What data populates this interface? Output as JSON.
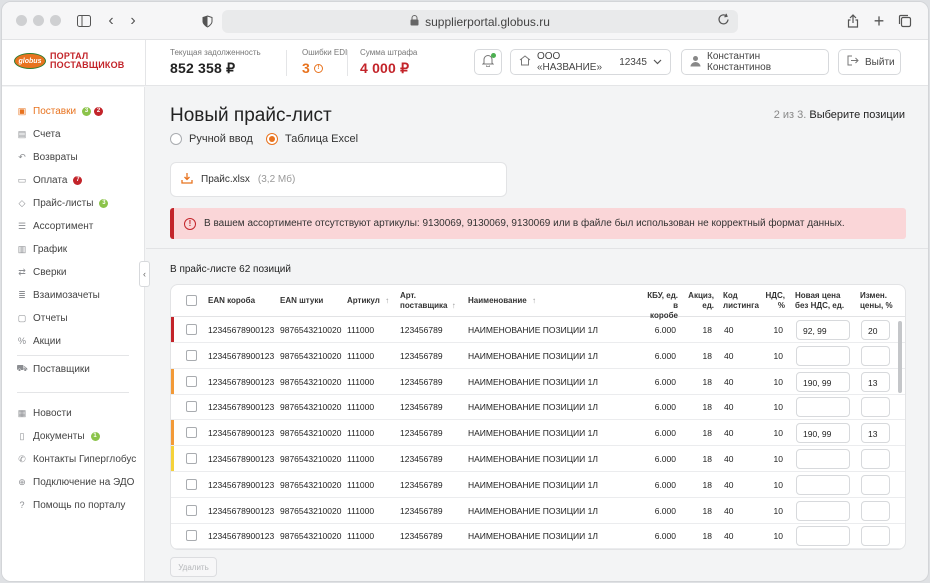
{
  "browser": {
    "url": "supplierportal.globus.ru"
  },
  "logo": {
    "badge": "globus",
    "line1": "ПОРТАЛ",
    "line2": "ПОСТАВЩИКОВ"
  },
  "header": {
    "debt_label": "Текущая задолженность",
    "debt_value": "852 358 ₽",
    "edi_label": "Ошибки EDI",
    "edi_value": "3",
    "fine_label": "Сумма штрафа",
    "fine_value": "4 000 ₽",
    "org_name": "ООО «НАЗВАНИЕ»",
    "org_code": "12345",
    "user_name": "Константин Константинов",
    "logout_label": "Выйти"
  },
  "sidebar": {
    "items": [
      {
        "label": "Поставки",
        "badges": [
          "3",
          "2"
        ],
        "icon": "box-icon"
      },
      {
        "label": "Счета",
        "icon": "document-icon"
      },
      {
        "label": "Возвраты",
        "icon": "return-icon"
      },
      {
        "label": "Оплата",
        "badges": [
          "7"
        ],
        "icon": "wallet-icon"
      },
      {
        "label": "Прайс-листы",
        "badges": [
          "3"
        ],
        "icon": "tag-icon"
      },
      {
        "label": "Ассортимент",
        "icon": "list-icon"
      },
      {
        "label": "График",
        "icon": "chart-icon"
      },
      {
        "label": "Сверки",
        "icon": "swap-icon"
      },
      {
        "label": "Взаимозачеты",
        "icon": "stack-icon"
      },
      {
        "label": "Отчеты",
        "icon": "report-icon"
      },
      {
        "label": "Акции",
        "icon": "percent-icon"
      },
      {
        "label": "Поставщики",
        "icon": "truck-icon"
      },
      {
        "label": "Новости",
        "icon": "news-icon"
      },
      {
        "label": "Документы",
        "badges": [
          "1"
        ],
        "icon": "file-icon"
      },
      {
        "label": "Контакты Гиперглобус",
        "icon": "phone-icon"
      },
      {
        "label": "Подключение на ЭДО",
        "icon": "plug-icon"
      },
      {
        "label": "Помощь по порталу",
        "icon": "help-icon"
      }
    ]
  },
  "page": {
    "title": "Новый прайс-лист",
    "step_prefix": "2 из 3.",
    "step_text": "Выберите позиции",
    "radio_manual": "Ручной ввод",
    "radio_excel": "Таблица Excel",
    "file_name": "Прайс.xlsx",
    "file_size": "(3,2 Мб)",
    "alert": "В вашем ассортименте отсутствуют артикулы: 9130069, 9130069, 9130069 или в файле был использован не корректный формат данных.",
    "count_text": "В прайс-листе 62 позиций",
    "delete_label": "Удалить"
  },
  "colors": {
    "accent": "#e8731f",
    "danger": "#c3242a",
    "green": "#2e7d32",
    "warning_orange": "#f29a38",
    "warning_yellow": "#f5d23a",
    "badge_green": "#8bc34a"
  },
  "table": {
    "headers": {
      "ean_box": "EAN короба",
      "ean_piece": "EAN штуки",
      "article": "Артикул",
      "supplier_article_1": "Арт.",
      "supplier_article_2": "поставщика",
      "name": "Наименование",
      "kbu_1": "КБУ, ед.",
      "kbu_2": "в коробе",
      "excise_1": "Акциз,",
      "excise_2": "ед.",
      "listing_1": "Код",
      "listing_2": "листинга",
      "vat_1": "НДС,",
      "vat_2": "%",
      "price_1": "Новая цена",
      "price_2": "без НДС, ед.",
      "change_1": "Измен.",
      "change_2": "цены, %"
    },
    "rows": [
      {
        "mark": "red",
        "ean_box": "12345678900123",
        "ean_piece": "9876543210020",
        "article": "111000",
        "supplier_article": "123456789",
        "name": "НАИМЕНОВАНИЕ ПОЗИЦИИ 1Л",
        "kbu": "6.000",
        "excise": "18",
        "listing": "40",
        "vat": "10",
        "price": "92, 99",
        "change": "20"
      },
      {
        "mark": "",
        "ean_box": "12345678900123",
        "ean_piece": "9876543210020",
        "article": "111000",
        "supplier_article": "123456789",
        "name": "НАИМЕНОВАНИЕ ПОЗИЦИИ 1Л",
        "kbu": "6.000",
        "excise": "18",
        "listing": "40",
        "vat": "10",
        "price": "",
        "change": ""
      },
      {
        "mark": "orange",
        "ean_box": "12345678900123",
        "ean_piece": "9876543210020",
        "article": "111000",
        "supplier_article": "123456789",
        "name": "НАИМЕНОВАНИЕ ПОЗИЦИИ 1Л",
        "kbu": "6.000",
        "excise": "18",
        "listing": "40",
        "vat": "10",
        "price": "190, 99",
        "change": "13"
      },
      {
        "mark": "",
        "ean_box": "12345678900123",
        "ean_piece": "9876543210020",
        "article": "111000",
        "supplier_article": "123456789",
        "name": "НАИМЕНОВАНИЕ ПОЗИЦИИ 1Л",
        "kbu": "6.000",
        "excise": "18",
        "listing": "40",
        "vat": "10",
        "price": "",
        "change": ""
      },
      {
        "mark": "orange",
        "ean_box": "12345678900123",
        "ean_piece": "9876543210020",
        "article": "111000",
        "supplier_article": "123456789",
        "name": "НАИМЕНОВАНИЕ ПОЗИЦИИ 1Л",
        "kbu": "6.000",
        "excise": "18",
        "listing": "40",
        "vat": "10",
        "price": "190, 99",
        "change": "13"
      },
      {
        "mark": "yellow",
        "ean_box": "12345678900123",
        "ean_piece": "9876543210020",
        "article": "111000",
        "supplier_article": "123456789",
        "name": "НАИМЕНОВАНИЕ ПОЗИЦИИ 1Л",
        "kbu": "6.000",
        "excise": "18",
        "listing": "40",
        "vat": "10",
        "price": "",
        "change": ""
      },
      {
        "mark": "",
        "ean_box": "12345678900123",
        "ean_piece": "9876543210020",
        "article": "111000",
        "supplier_article": "123456789",
        "name": "НАИМЕНОВАНИЕ ПОЗИЦИИ 1Л",
        "kbu": "6.000",
        "excise": "18",
        "listing": "40",
        "vat": "10",
        "price": "",
        "change": ""
      },
      {
        "mark": "",
        "ean_box": "12345678900123",
        "ean_piece": "9876543210020",
        "article": "111000",
        "supplier_article": "123456789",
        "name": "НАИМЕНОВАНИЕ ПОЗИЦИИ 1Л",
        "kbu": "6.000",
        "excise": "18",
        "listing": "40",
        "vat": "10",
        "price": "",
        "change": ""
      },
      {
        "mark": "",
        "ean_box": "12345678900123",
        "ean_piece": "9876543210020",
        "article": "111000",
        "supplier_article": "123456789",
        "name": "НАИМЕНОВАНИЕ ПОЗИЦИИ 1Л",
        "kbu": "6.000",
        "excise": "18",
        "listing": "40",
        "vat": "10",
        "price": "",
        "change": ""
      }
    ]
  }
}
